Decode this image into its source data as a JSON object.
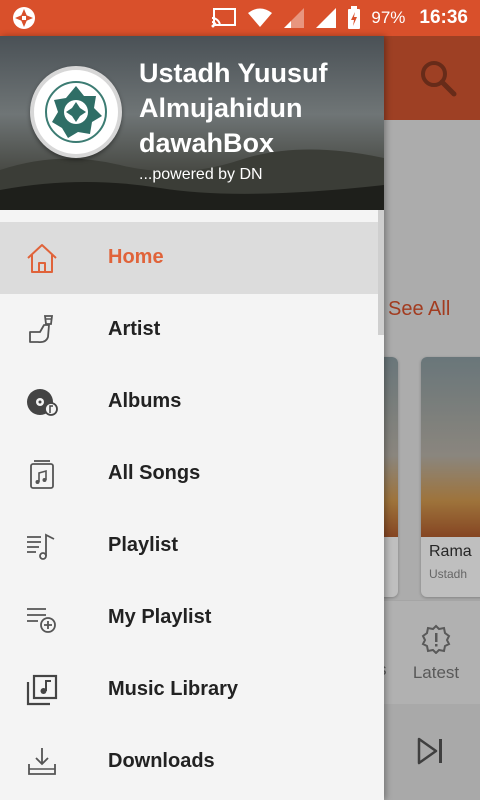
{
  "status_bar": {
    "battery": "97%",
    "time": "16:36",
    "icons": [
      "aperture-icon",
      "cast-icon",
      "wifi-icon",
      "signal-weak-icon",
      "signal-icon",
      "battery-charging-icon"
    ]
  },
  "background": {
    "see_all": "See All",
    "cards": [
      {
        "title": "",
        "subtitle": ""
      },
      {
        "title": "Rama",
        "subtitle": "Ustadh"
      }
    ],
    "tab_partial": "s",
    "tab_latest": "Latest"
  },
  "drawer": {
    "title": "Ustadh Yuusuf Almujahidun dawahBox",
    "subtitle": "...powered by DN",
    "items": [
      {
        "label": "Home",
        "icon": "home-icon",
        "active": true
      },
      {
        "label": "Artist",
        "icon": "artist-icon",
        "active": false
      },
      {
        "label": "Albums",
        "icon": "album-disc-icon",
        "active": false
      },
      {
        "label": "All Songs",
        "icon": "songs-icon",
        "active": false
      },
      {
        "label": "Playlist",
        "icon": "playlist-icon",
        "active": false
      },
      {
        "label": "My Playlist",
        "icon": "playlist-add-icon",
        "active": false
      },
      {
        "label": "Music Library",
        "icon": "music-library-icon",
        "active": false
      },
      {
        "label": "Downloads",
        "icon": "download-icon",
        "active": false
      }
    ]
  },
  "colors": {
    "accent": "#d9502b",
    "active_label": "#e0633a",
    "active_bg": "#dcdcdc"
  }
}
